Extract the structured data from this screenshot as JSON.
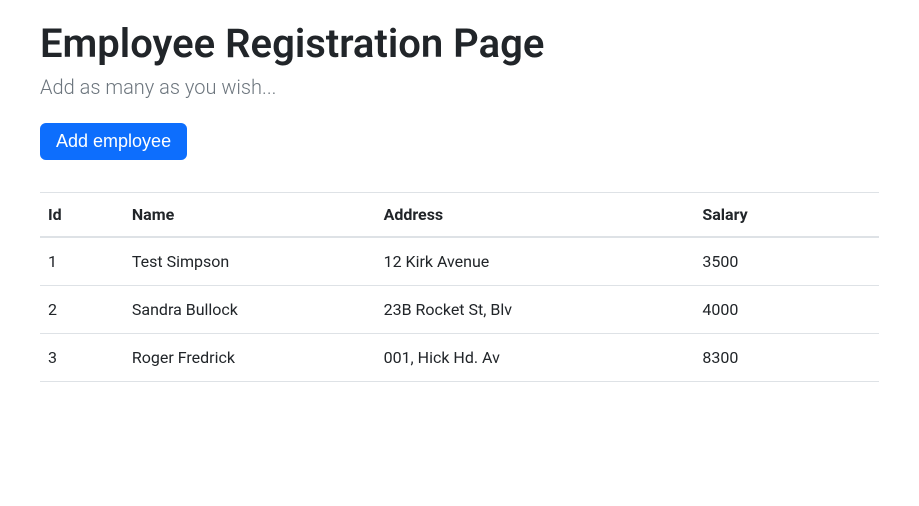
{
  "header": {
    "title": "Employee Registration Page",
    "subtitle": "Add as many as you wish..."
  },
  "actions": {
    "add_employee_label": "Add employee"
  },
  "table": {
    "columns": {
      "id": "Id",
      "name": "Name",
      "address": "Address",
      "salary": "Salary"
    },
    "rows": [
      {
        "id": "1",
        "name": "Test Simpson",
        "address": "12 Kirk Avenue",
        "salary": "3500"
      },
      {
        "id": "2",
        "name": "Sandra Bullock",
        "address": "23B Rocket St, Blv",
        "salary": "4000"
      },
      {
        "id": "3",
        "name": "Roger Fredrick",
        "address": "001, Hick Hd. Av",
        "salary": "8300"
      }
    ]
  }
}
